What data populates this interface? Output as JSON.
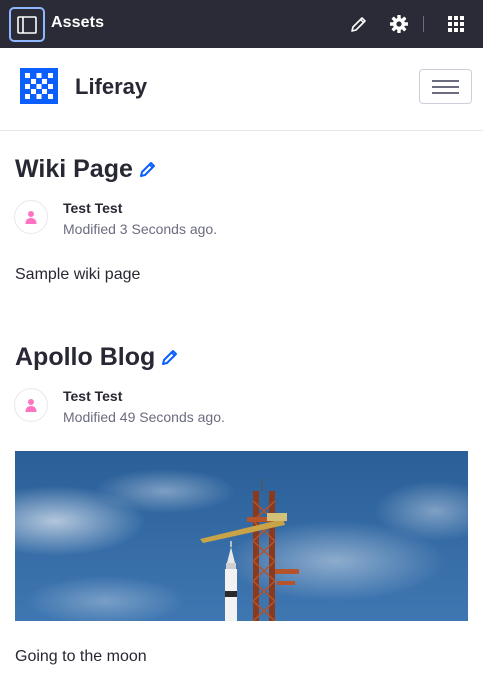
{
  "control_menu": {
    "title": "Assets",
    "icons": [
      "sidebar-toggle-icon",
      "pencil-icon",
      "cog-icon",
      "grid-icon"
    ],
    "background": "#2a2b36"
  },
  "site": {
    "name": "Liferay",
    "logo_color": "#0b5fff"
  },
  "assets": [
    {
      "title": "Wiki Page",
      "author": "Test Test",
      "modified": "Modified 3 Seconds ago.",
      "body": "Sample wiki page"
    },
    {
      "title": "Apollo Blog",
      "author": "Test Test",
      "modified": "Modified 49 Seconds ago.",
      "body": "Going to the moon"
    }
  ],
  "colors": {
    "accent": "#0b5fff",
    "avatar_icon": "#ff73c3"
  }
}
